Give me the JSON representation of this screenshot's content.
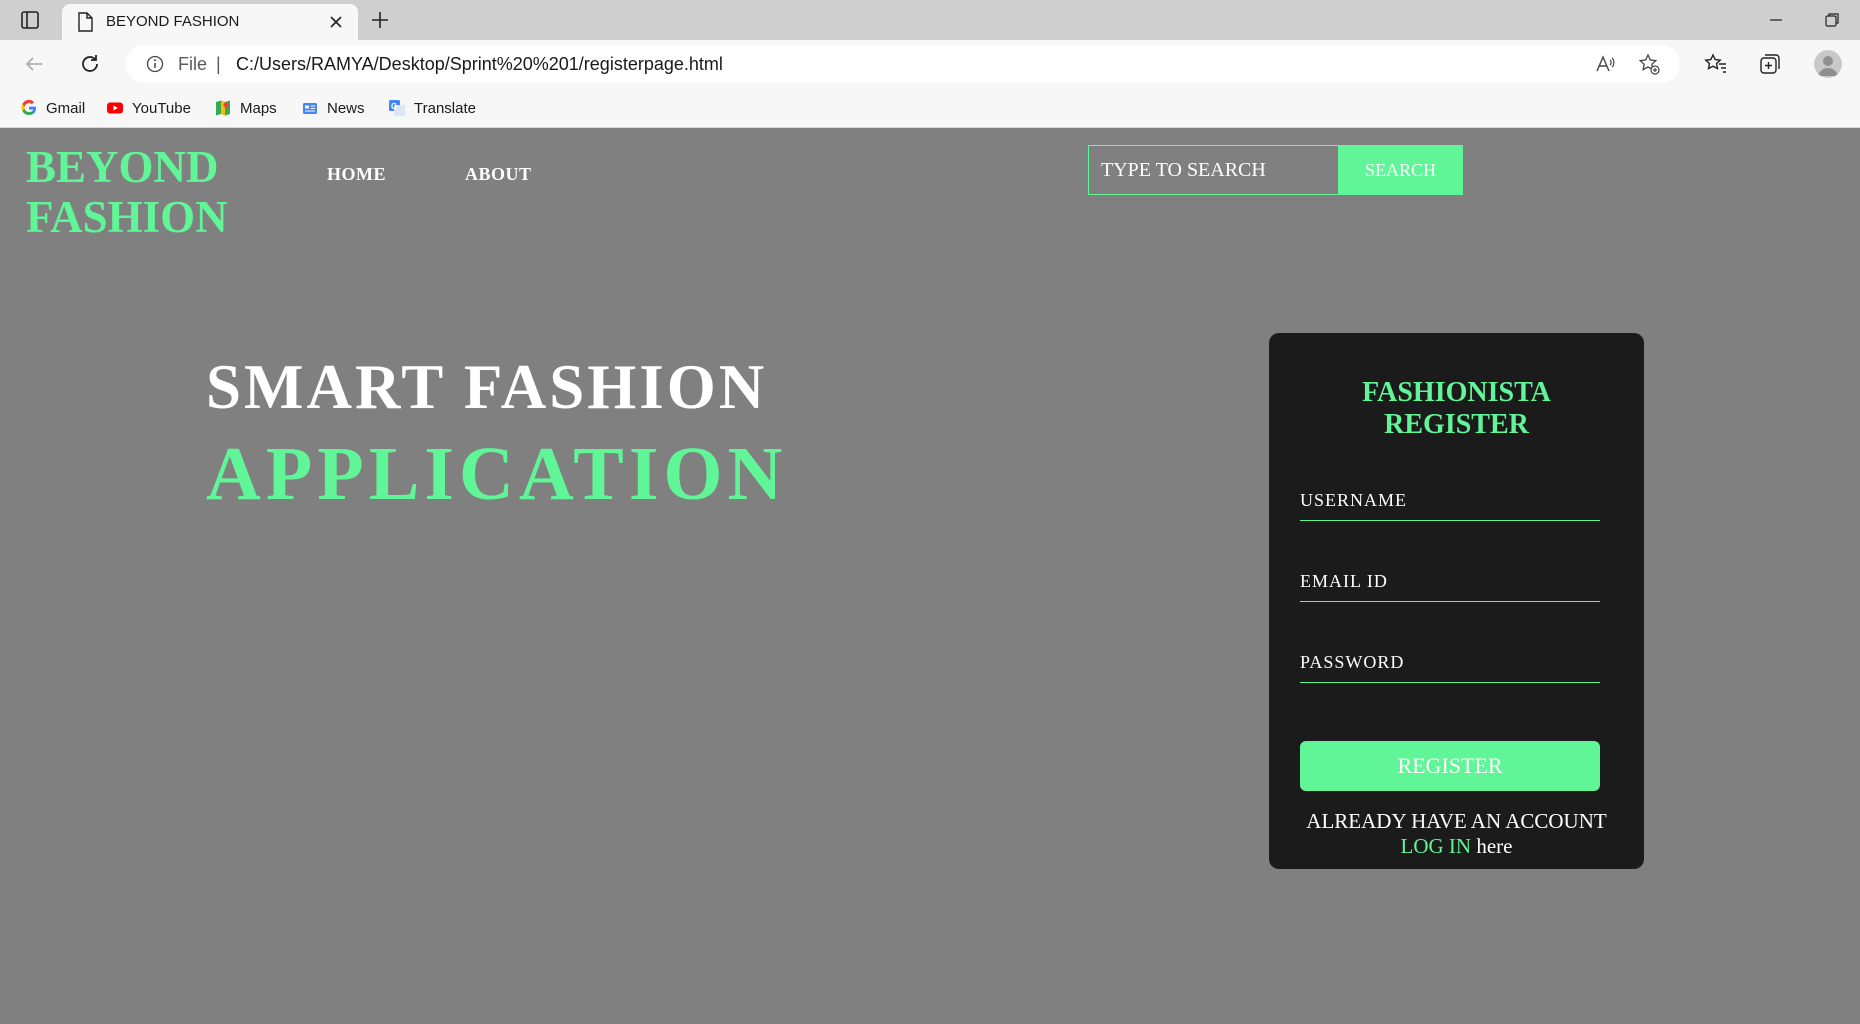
{
  "browser": {
    "tab_title": "BEYOND FASHION",
    "file_label": "File",
    "url_separator": "|",
    "url": "C:/Users/RAMYA/Desktop/Sprint%20%201/registerpage.html",
    "bookmarks": [
      {
        "label": "Gmail",
        "icon": "gmail-icon"
      },
      {
        "label": "YouTube",
        "icon": "youtube-icon"
      },
      {
        "label": "Maps",
        "icon": "maps-icon"
      },
      {
        "label": "News",
        "icon": "news-icon"
      },
      {
        "label": "Translate",
        "icon": "translate-icon"
      }
    ]
  },
  "site": {
    "brand_line1": "BEYOND",
    "brand_line2": "FASHION",
    "nav": {
      "home": "HOME",
      "about": "ABOUT"
    },
    "search": {
      "placeholder": "TYPE TO SEARCH",
      "button": "SEARCH"
    }
  },
  "hero": {
    "line1": "SMART FASHION",
    "line2": "APPLICATION"
  },
  "register_card": {
    "title_line1": "FASHIONISTA",
    "title_line2": "REGISTER",
    "username_placeholder": "USERNAME",
    "email_placeholder": "EMAIL ID",
    "password_placeholder": "PASSWORD",
    "register_button": "REGISTER",
    "footer_text": "ALREADY HAVE AN ACCOUNT",
    "login_link": "LOG IN",
    "login_suffix": " here"
  },
  "colors": {
    "accent": "#60f597",
    "page_bg": "#808080",
    "card_bg": "#1b1b1b"
  }
}
